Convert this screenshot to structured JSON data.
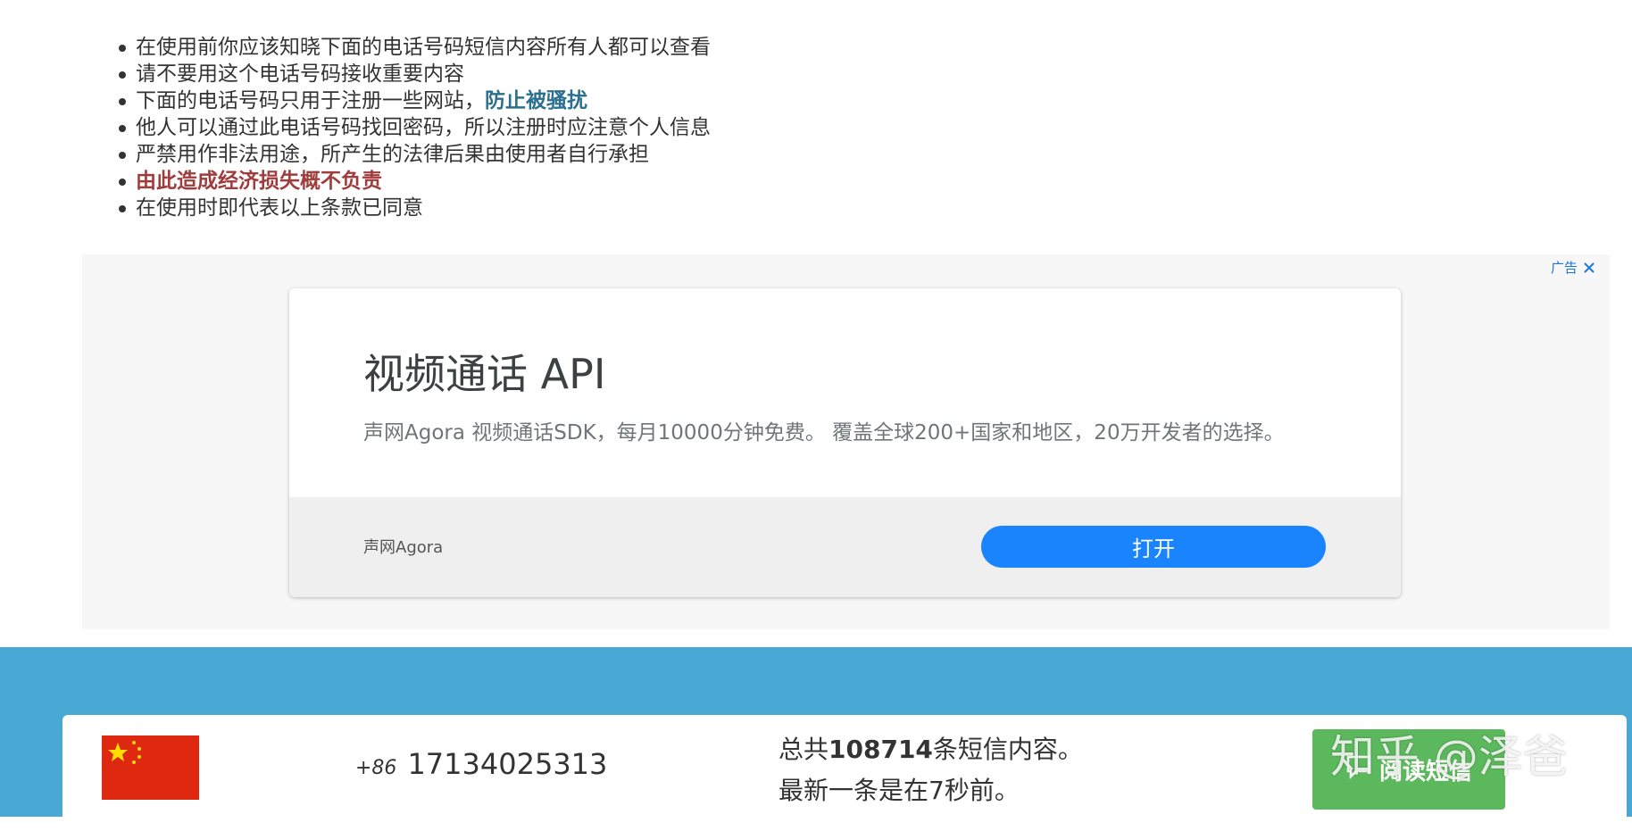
{
  "notice": {
    "items": [
      {
        "text": "在使用前你应该知晓下面的电话号码短信内容所有人都可以查看"
      },
      {
        "text": "请不要用这个电话号码接收重要内容"
      },
      {
        "text": "下面的电话号码只用于注册一些网站，",
        "link": "防止被骚扰"
      },
      {
        "text": "他人可以通过此电话号码找回密码，所以注册时应注意个人信息"
      },
      {
        "text": "严禁用作非法用途，所产生的法律后果由使用者自行承担"
      },
      {
        "text": "由此造成经济损失概不负责"
      },
      {
        "text": "在使用时即代表以上条款已同意"
      }
    ]
  },
  "ad": {
    "choices_label": "广告",
    "title": "视频通话 API",
    "description": "声网Agora 视频通话SDK，每月10000分钟免费。 覆盖全球200+国家和地区，20万开发者的选择。",
    "brand": "声网Agora",
    "open_button": "打开",
    "button_color": "#1a84ff"
  },
  "number_card": {
    "country_code": "+86",
    "phone_number": "17134025313",
    "stats_prefix": "总共",
    "stats_count": "108714",
    "stats_suffix": "条短信内容。",
    "latest": "最新一条是在7秒前。",
    "read_button": "阅读短信",
    "flag": "china-flag",
    "band_color": "#4aa9d4",
    "button_color": "#5cb85c"
  },
  "watermark": "知乎 @泽爸"
}
